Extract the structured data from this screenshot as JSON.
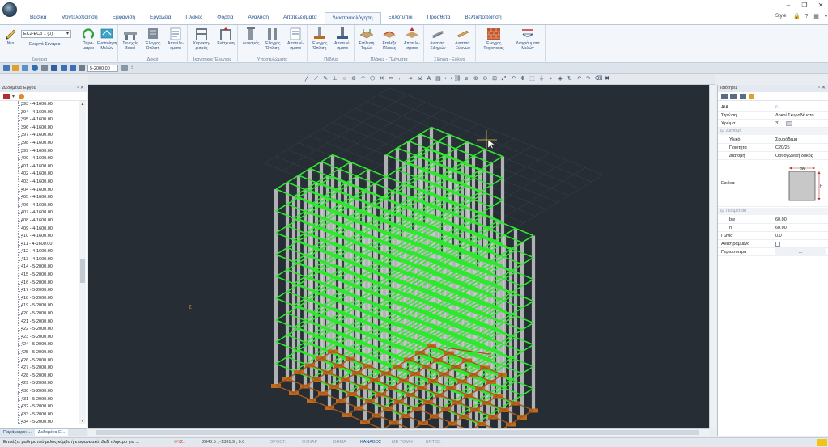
{
  "menu": {
    "tabs": [
      "Βασικά",
      "Μοντελοποίηση",
      "Εμφάνιση",
      "Εργαλεία",
      "Πλάκες",
      "Φορτία",
      "Ανάλυση",
      "Αποτελέσματα",
      "Διαστασιολόγηση",
      "Ξυλότυποι",
      "Πρόσθετα",
      "Βελτιστοποίηση"
    ],
    "active_tab": "Διαστασιολόγηση"
  },
  "style_label": "Style",
  "ribbon": {
    "scenario_value": "EC2-EC3 1 (0)",
    "active_scenario_label": "Ενεργό Σενάριο",
    "new_label": "Νέο",
    "groups": {
      "scenarios": "Σενάρια",
      "beams": "Δοκοί",
      "capacity": "Ικανοτικός Έλεγχος",
      "columns": "Υποστυλώματα",
      "footings": "Πέδιλα",
      "slabs": "Πλάκες - Πλέγματα",
      "steel_wood": "Σίδηρα - Ξύλινα",
      "walls": ""
    },
    "buttons": {
      "parameters": "Παρά-\nμετροι",
      "beam_unify": "Ενοποίηση\nΜελών",
      "beam_continuous": "Συνεχείς\nδοκοί",
      "beam_check": "Έλεγχος\nΌπλιση",
      "beam_results": "Αποτέλε-\nσματα",
      "cap_char": "Χαρακτη-\nρισμός",
      "cap_reinf": "Ενίσχυση",
      "col_calc": "Λυγισμός",
      "col_check": "Έλεγχος\nΌπλιση",
      "col_results": "Αποτελέ-\nσματα",
      "foot_check": "Έλεγχος\nΌπλιση",
      "foot_results": "Αποτελέ-\nσματα",
      "slab_check": "Επίλυση\nΤομών",
      "slab_strips": "Επιλέξε\nΠλάκες",
      "slab_results": "Αποτελέ-\nσματα",
      "steel_dim": "Διαστασ.\nΣιδηρών",
      "wood_dim": "Διαστασ.\nΞύλινων",
      "wall_check": "Έλεγχος\nΤοιχοποιίας",
      "wall_diagrams": "Διαγράμματα\nΜελών"
    }
  },
  "quickbar": {
    "level_value": "5-2000.00"
  },
  "left_panel": {
    "title": "Δεδομένα Έργου",
    "items": [
      "393 - 4-1600.00",
      "394 - 4-1600.00",
      "395 - 4-1600.00",
      "396 - 4-1600.00",
      "397 - 4-1600.00",
      "398 - 4-1600.00",
      "399 - 4-1600.00",
      "400 - 4-1600.00",
      "401 - 4-1600.00",
      "402 - 4-1600.00",
      "403 - 4-1600.00",
      "404 - 4-1600.00",
      "405 - 4-1600.00",
      "406 - 4-1600.00",
      "407 - 4-1600.00",
      "408 - 4-1600.00",
      "409 - 4-1600.00",
      "410 - 4-1600.00",
      "411 - 4-1600.00",
      "412 - 4-1600.00",
      "413 - 4-1600.00",
      "414 - 5-2000.00",
      "415 - 5-2000.00",
      "416 - 5-2000.00",
      "417 - 5-2000.00",
      "418 - 5-2000.00",
      "419 - 5-2000.00",
      "420 - 5-2000.00",
      "421 - 5-2000.00",
      "422 - 5-2000.00",
      "423 - 5-2000.00",
      "424 - 5-2000.00",
      "425 - 5-2000.00",
      "426 - 5-2000.00",
      "427 - 5-2000.00",
      "428 - 5-2000.00",
      "429 - 5-2000.00",
      "430 - 5-2000.00",
      "431 - 5-2000.00",
      "432 - 5-2000.00",
      "433 - 5-2000.00",
      "434 - 5-2000.00"
    ]
  },
  "viewport": {
    "axis_x": "X",
    "axis_z": "Z"
  },
  "properties": {
    "title": "Ιδιότητες",
    "rows": {
      "aa_key": "Α/Α",
      "aa_val": "6",
      "layer_key": "Στρώση",
      "layer_val": "Δοκοί Σκυροδέματο...",
      "color_key": "Χρώμα",
      "color_val": "31",
      "cat_section": "Διατομή",
      "material_key": "Υλικό",
      "material_val": "Σκυρόδεμα",
      "quality_key": "Ποιότητα",
      "quality_val": "C20/25",
      "section_key": "Διατομή",
      "section_val": "Ορθογωνική δοκός",
      "image_key": "Εικόνα",
      "cat_geometry": "Γεωμετρία",
      "bw_key": "bw",
      "bw_val": "60.00",
      "h_key": "h",
      "h_val": "60.00",
      "angle_key": "Γωνία",
      "angle_val": "0.0",
      "inverted_key": "Ανεστραμμένο",
      "more_key": "Περισσότερα",
      "more_val": "..."
    },
    "image_label_bw": "bw",
    "image_label_h": "h"
  },
  "bottom_tabs": [
    "Παράμετροι ...",
    "Δεδομένα Ε..."
  ],
  "status": {
    "message": "Επιλέξτε μαθηματικό μέλος κόμβο ή επιφανειακό. Δεξί πλήκτρο για ...",
    "fx": "ΦΥΣ.",
    "coords": "2840.5 , -1381.9 , 0.0",
    "snaps": [
      "ΟΡΘΟΓ.",
      "OSNAP",
      "ΒΗΜΑ",
      "ΚΑΝΑΒΟΣ",
      "ΜΕ ΤΟΜΗ",
      "ΕΝΤΟΣ"
    ],
    "active_snap": "ΚΑΝΑΒΟΣ"
  },
  "colors": {
    "viewport_bg": "#262d34",
    "beam_green": "#2ee82e",
    "column_gray": "#c9c9c9",
    "footing_brown": "#c06a1c",
    "axis_red": "#e02020",
    "accent_blue": "#1f4e8c"
  }
}
